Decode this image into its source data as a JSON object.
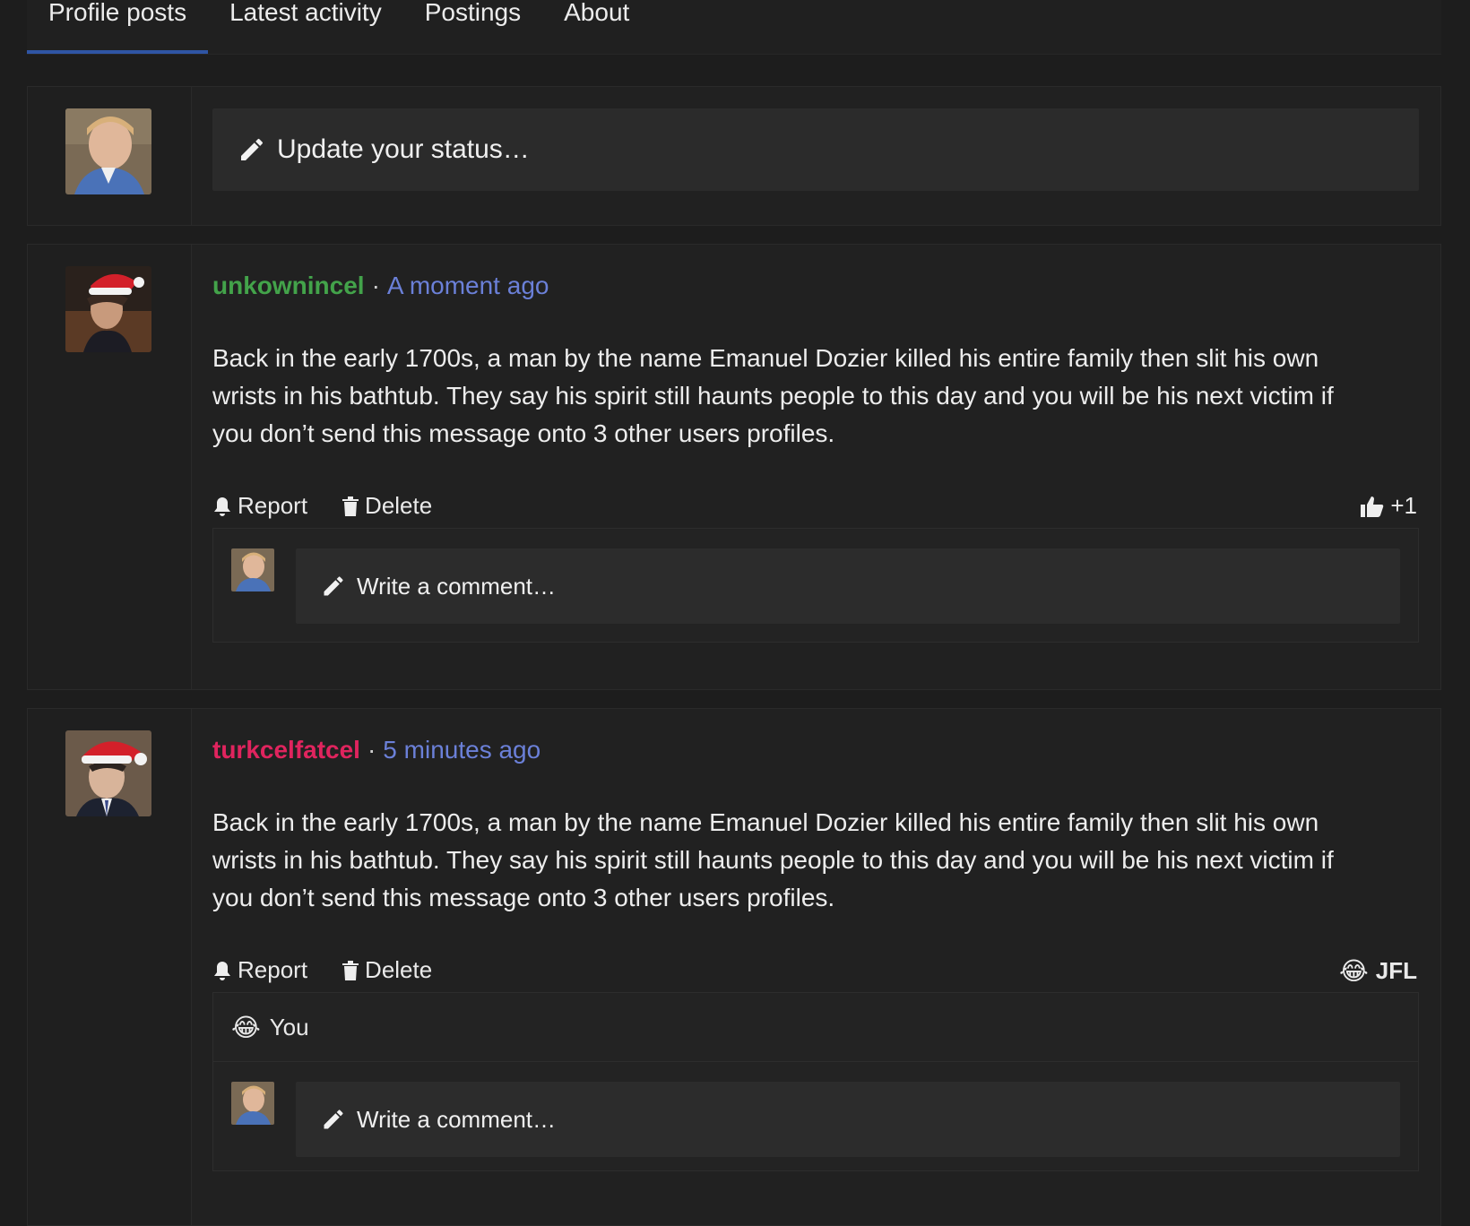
{
  "tabs": [
    {
      "label": "Profile posts"
    },
    {
      "label": "Latest activity"
    },
    {
      "label": "Postings"
    },
    {
      "label": "About"
    }
  ],
  "status": {
    "placeholder": "Update your status…"
  },
  "posts": [
    {
      "username": "unkownincel",
      "separator": "·",
      "time": "A moment ago",
      "body": "Back in the early 1700s, a man by the name Emanuel Dozier killed his entire family then slit his own wrists in his bathtub. They say his spirit still haunts people to this day and you will be his next victim if you don’t send this message onto 3 other users profiles.",
      "report_label": "Report",
      "delete_label": "Delete",
      "reaction": {
        "icon": "thumbs-up-icon",
        "label": "+1"
      },
      "comment_placeholder": "Write a comment…"
    },
    {
      "username": "turkcelfatcel",
      "separator": "·",
      "time": "5 minutes ago",
      "body": "Back in the early 1700s, a man by the name Emanuel Dozier killed his entire family then slit his own wrists in his bathtub. They say his spirit still haunts people to this day and you will be his next victim if you don’t send this message onto 3 other users profiles.",
      "report_label": "Report",
      "delete_label": "Delete",
      "reaction": {
        "icon": "crying-laughing-emoji",
        "emoji": "😂",
        "label": "JFL"
      },
      "reactors": {
        "emoji": "😂",
        "label": "You"
      },
      "comment_placeholder": "Write a comment…"
    }
  ],
  "colors": {
    "background": "#1d1d1d",
    "tab_active_underline": "#2f55a4",
    "username_1": "#43a34a",
    "username_2": "#e0245e",
    "time": "#6b80d8"
  }
}
